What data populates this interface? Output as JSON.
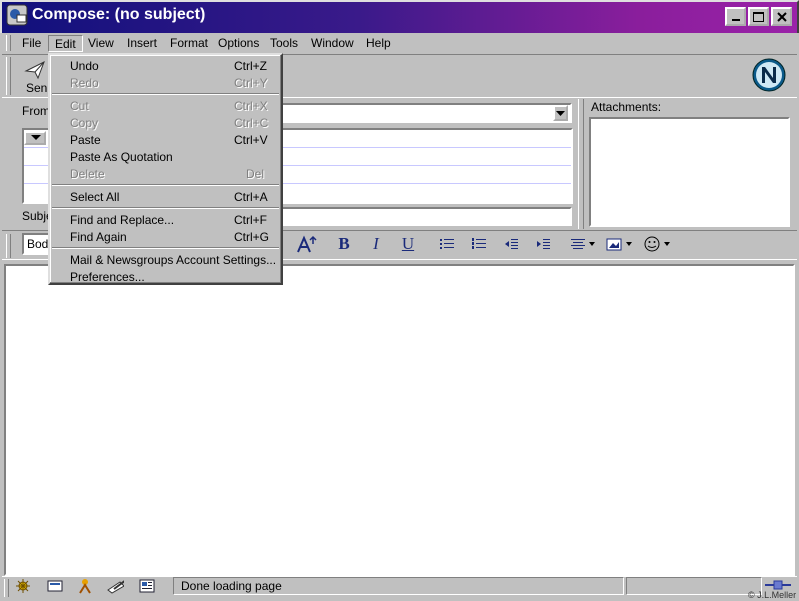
{
  "window": {
    "title": "Compose: (no subject)",
    "caption_buttons": [
      "minimize-icon",
      "maximize-icon",
      "close-icon"
    ]
  },
  "menubar": {
    "items": [
      "File",
      "Edit",
      "View",
      "Insert",
      "Format",
      "Options",
      "Tools",
      "Window",
      "Help"
    ],
    "active": "Edit"
  },
  "toolbar": {
    "send_label": "Sen",
    "logo": "netscape-logo"
  },
  "address": {
    "from_label": "From",
    "subject_label": "Subje",
    "attachments_label": "Attachments:"
  },
  "format": {
    "style_value": "Bod",
    "icons": [
      "font-size-icon",
      "bold-icon",
      "italic-icon",
      "underline-icon",
      "bullet-list-icon",
      "numbered-list-icon",
      "outdent-icon",
      "indent-icon",
      "align-icon",
      "insert-object-icon",
      "smiley-icon"
    ]
  },
  "edit_menu": {
    "items": [
      {
        "label": "Undo",
        "shortcut": "Ctrl+Z",
        "enabled": true
      },
      {
        "label": "Redo",
        "shortcut": "Ctrl+Y",
        "enabled": false
      },
      {
        "label": "Cut",
        "shortcut": "Ctrl+X",
        "enabled": false
      },
      {
        "label": "Copy",
        "shortcut": "Ctrl+C",
        "enabled": false
      },
      {
        "label": "Paste",
        "shortcut": "Ctrl+V",
        "enabled": true
      },
      {
        "label": "Paste As Quotation",
        "shortcut": "",
        "enabled": true
      },
      {
        "label": "Delete",
        "shortcut": "Del",
        "enabled": false
      },
      {
        "label": "Select All",
        "shortcut": "Ctrl+A",
        "enabled": true
      },
      {
        "label": "Find and Replace...",
        "shortcut": "Ctrl+F",
        "enabled": true
      },
      {
        "label": "Find Again",
        "shortcut": "Ctrl+G",
        "enabled": true
      },
      {
        "label": "Mail & Newsgroups Account Settings...",
        "shortcut": "",
        "enabled": true
      },
      {
        "label": "Preferences...",
        "shortcut": "",
        "enabled": true
      }
    ]
  },
  "status": {
    "text": "Done loading page",
    "icons": [
      "navigator-icon",
      "mail-icon",
      "composer-icon",
      "address-book-icon",
      "news-icon"
    ],
    "copyright": "© J.L.Meller"
  },
  "colors": {
    "titlebar_start": "#10107c",
    "titlebar_end": "#9a22a8",
    "chrome": "#c0c0c0"
  }
}
